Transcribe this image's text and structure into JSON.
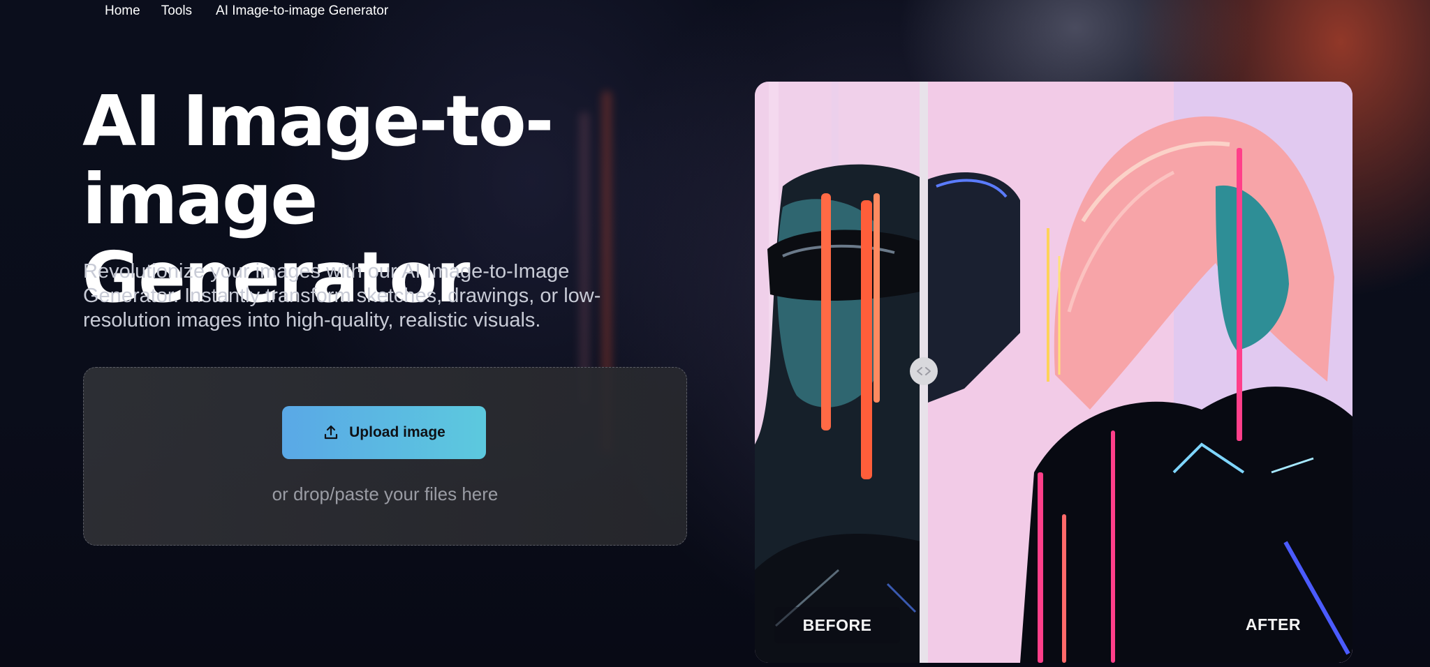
{
  "breadcrumb": {
    "home": "Home",
    "tools": "Tools",
    "current": "AI Image-to-image Generator"
  },
  "hero": {
    "title_line1": "AI Image-to-",
    "title_line2": "image Generator",
    "description": "Revolutionize your images with our AI Image-to-Image Generator. Instantly transform sketches, drawings, or low-resolution images into high-quality, realistic visuals."
  },
  "upload": {
    "button_label": "Upload image",
    "drop_hint": "or drop/paste your files here",
    "button_icon": "upload-icon"
  },
  "comparison": {
    "before_label": "BEFORE",
    "after_label": "AFTER",
    "handle_icon": "code-arrows-icon"
  },
  "colors": {
    "accent_gradient_start": "#5aa8e6",
    "accent_gradient_end": "#5cc9de",
    "page_background": "#0b0e1c"
  }
}
